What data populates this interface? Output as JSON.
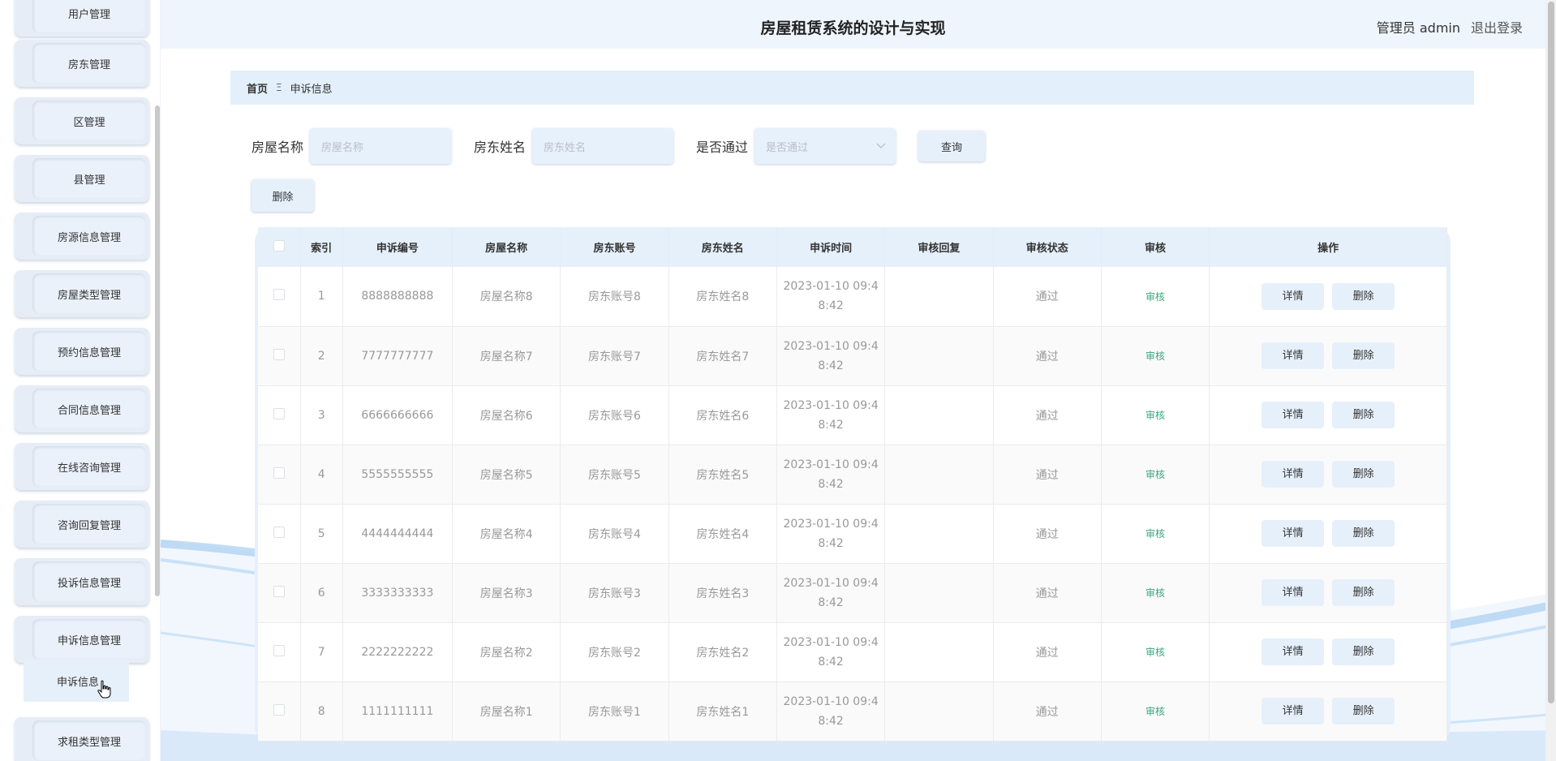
{
  "header": {
    "title": "房屋租赁系统的设计与实现",
    "admin_label": "管理员 admin",
    "logout_label": "退出登录"
  },
  "sidebar": {
    "items": [
      {
        "label": "用户管理"
      },
      {
        "label": "房东管理"
      },
      {
        "label": "区管理"
      },
      {
        "label": "县管理"
      },
      {
        "label": "房源信息管理"
      },
      {
        "label": "房屋类型管理"
      },
      {
        "label": "预约信息管理"
      },
      {
        "label": "合同信息管理"
      },
      {
        "label": "在线咨询管理"
      },
      {
        "label": "咨询回复管理"
      },
      {
        "label": "投诉信息管理"
      },
      {
        "label": "申诉信息管理"
      },
      {
        "label": "求租类型管理"
      }
    ],
    "active_sub": "申诉信息"
  },
  "breadcrumb": {
    "home": "首页",
    "separator": "Ξ",
    "current": "申诉信息"
  },
  "search": {
    "house_name_label": "房屋名称",
    "house_name_placeholder": "房屋名称",
    "landlord_name_label": "房东姓名",
    "landlord_name_placeholder": "房东姓名",
    "passed_label": "是否通过",
    "passed_placeholder": "是否通过",
    "query_label": "查询"
  },
  "toolbar": {
    "delete_label": "删除"
  },
  "table": {
    "headers": [
      "索引",
      "申诉编号",
      "房屋名称",
      "房东账号",
      "房东姓名",
      "申诉时间",
      "审核回复",
      "审核状态",
      "审核",
      "操作"
    ],
    "rows": [
      {
        "index": "1",
        "no": "8888888888",
        "house": "房屋名称8",
        "account": "房东账号8",
        "name": "房东姓名8",
        "time_a": "2023-01-10 09:4",
        "time_b": "8:42",
        "reply": "",
        "status": "通过",
        "audit": "审核",
        "detail": "详情",
        "delete": "删除"
      },
      {
        "index": "2",
        "no": "7777777777",
        "house": "房屋名称7",
        "account": "房东账号7",
        "name": "房东姓名7",
        "time_a": "2023-01-10 09:4",
        "time_b": "8:42",
        "reply": "",
        "status": "通过",
        "audit": "审核",
        "detail": "详情",
        "delete": "删除"
      },
      {
        "index": "3",
        "no": "6666666666",
        "house": "房屋名称6",
        "account": "房东账号6",
        "name": "房东姓名6",
        "time_a": "2023-01-10 09:4",
        "time_b": "8:42",
        "reply": "",
        "status": "通过",
        "audit": "审核",
        "detail": "详情",
        "delete": "删除"
      },
      {
        "index": "4",
        "no": "5555555555",
        "house": "房屋名称5",
        "account": "房东账号5",
        "name": "房东姓名5",
        "time_a": "2023-01-10 09:4",
        "time_b": "8:42",
        "reply": "",
        "status": "通过",
        "audit": "审核",
        "detail": "详情",
        "delete": "删除"
      },
      {
        "index": "5",
        "no": "4444444444",
        "house": "房屋名称4",
        "account": "房东账号4",
        "name": "房东姓名4",
        "time_a": "2023-01-10 09:4",
        "time_b": "8:42",
        "reply": "",
        "status": "通过",
        "audit": "审核",
        "detail": "详情",
        "delete": "删除"
      },
      {
        "index": "6",
        "no": "3333333333",
        "house": "房屋名称3",
        "account": "房东账号3",
        "name": "房东姓名3",
        "time_a": "2023-01-10 09:4",
        "time_b": "8:42",
        "reply": "",
        "status": "通过",
        "audit": "审核",
        "detail": "详情",
        "delete": "删除"
      },
      {
        "index": "7",
        "no": "2222222222",
        "house": "房屋名称2",
        "account": "房东账号2",
        "name": "房东姓名2",
        "time_a": "2023-01-10 09:4",
        "time_b": "8:42",
        "reply": "",
        "status": "通过",
        "audit": "审核",
        "detail": "详情",
        "delete": "删除"
      },
      {
        "index": "8",
        "no": "1111111111",
        "house": "房屋名称1",
        "account": "房东账号1",
        "name": "房东姓名1",
        "time_a": "2023-01-10 09:4",
        "time_b": "8:42",
        "reply": "",
        "status": "通过",
        "audit": "审核",
        "detail": "详情",
        "delete": "删除"
      }
    ]
  },
  "colors": {
    "accent_bg": "#e6f0fb",
    "header_bg": "#eef5fd",
    "audit_green": "#3aa77c"
  }
}
